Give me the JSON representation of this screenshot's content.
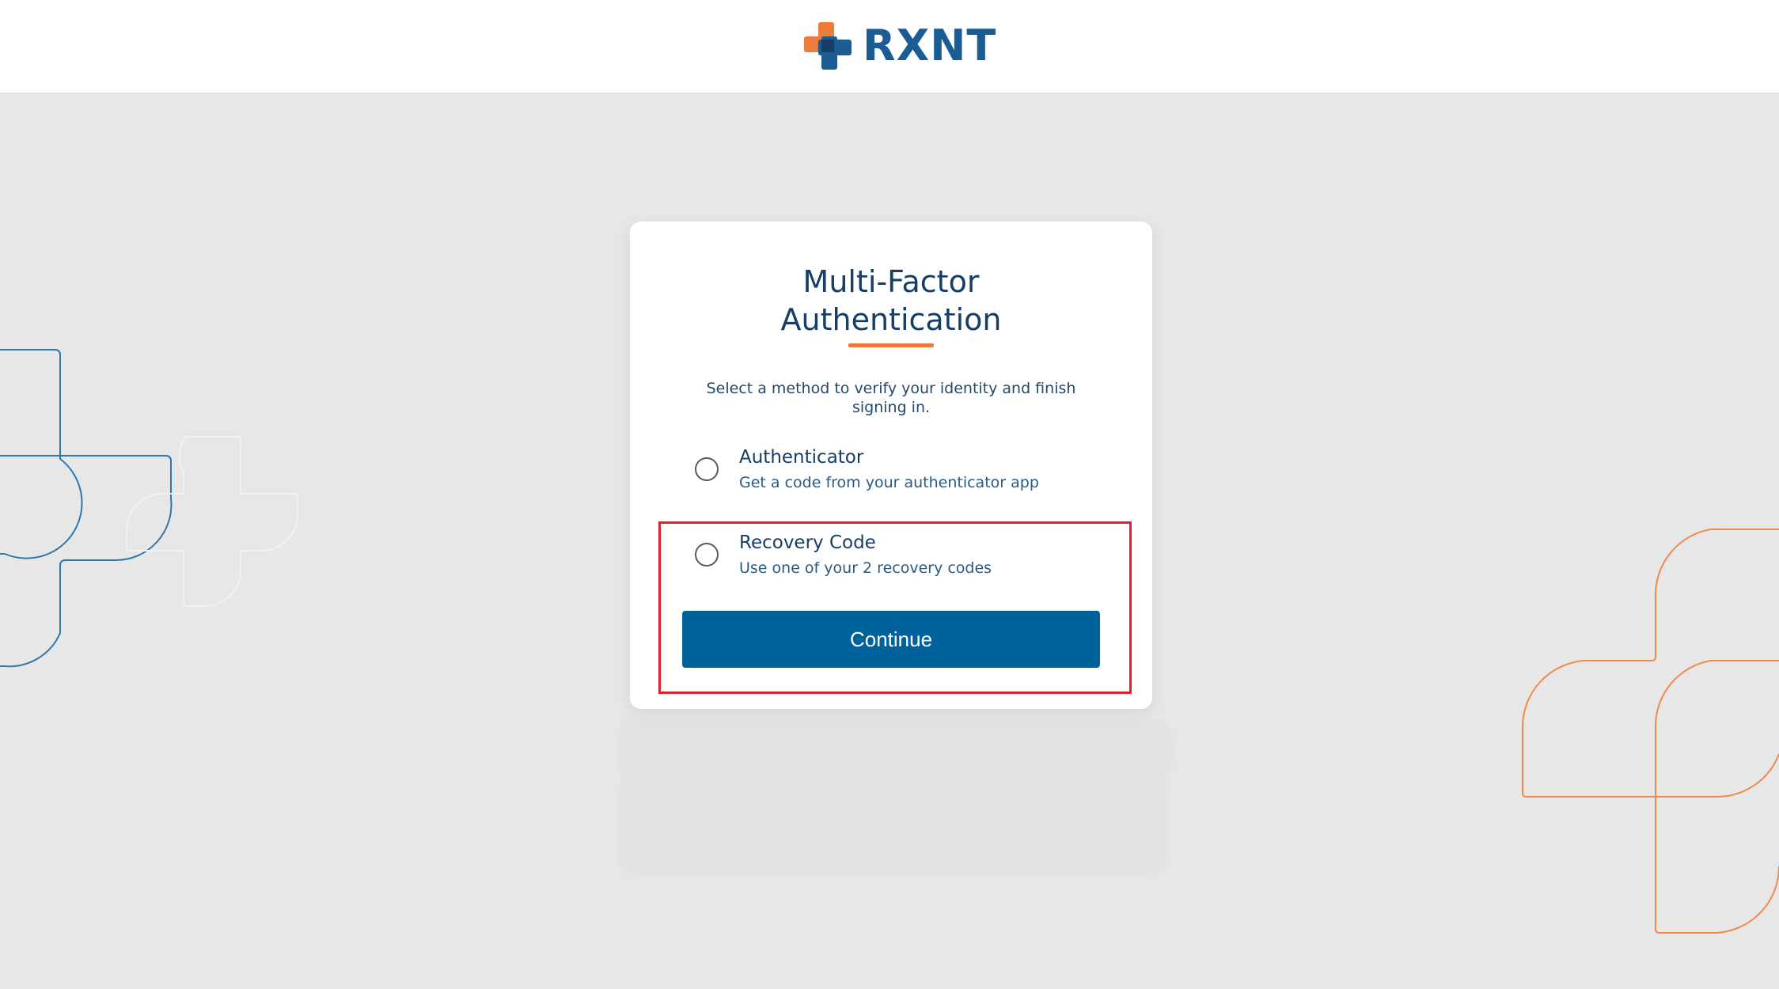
{
  "header": {
    "brand": "RXNT",
    "logo_icon": "cross-logo-icon"
  },
  "card": {
    "title_line1": "Multi-Factor",
    "title_line2": "Authentication",
    "subtitle": "Select a method to verify your identity and finish signing in.",
    "options": [
      {
        "title": "Authenticator",
        "description": "Get a code from your authenticator app",
        "selected": false
      },
      {
        "title": "Recovery Code",
        "description": "Use one of your 2 recovery codes",
        "selected": false
      }
    ],
    "continue_label": "Continue"
  },
  "colors": {
    "brand_blue": "#1b5c93",
    "button_blue": "#00629b",
    "accent_orange": "#ef7b3a",
    "highlight_red": "#e0202b",
    "background": "#e7e7e7"
  }
}
